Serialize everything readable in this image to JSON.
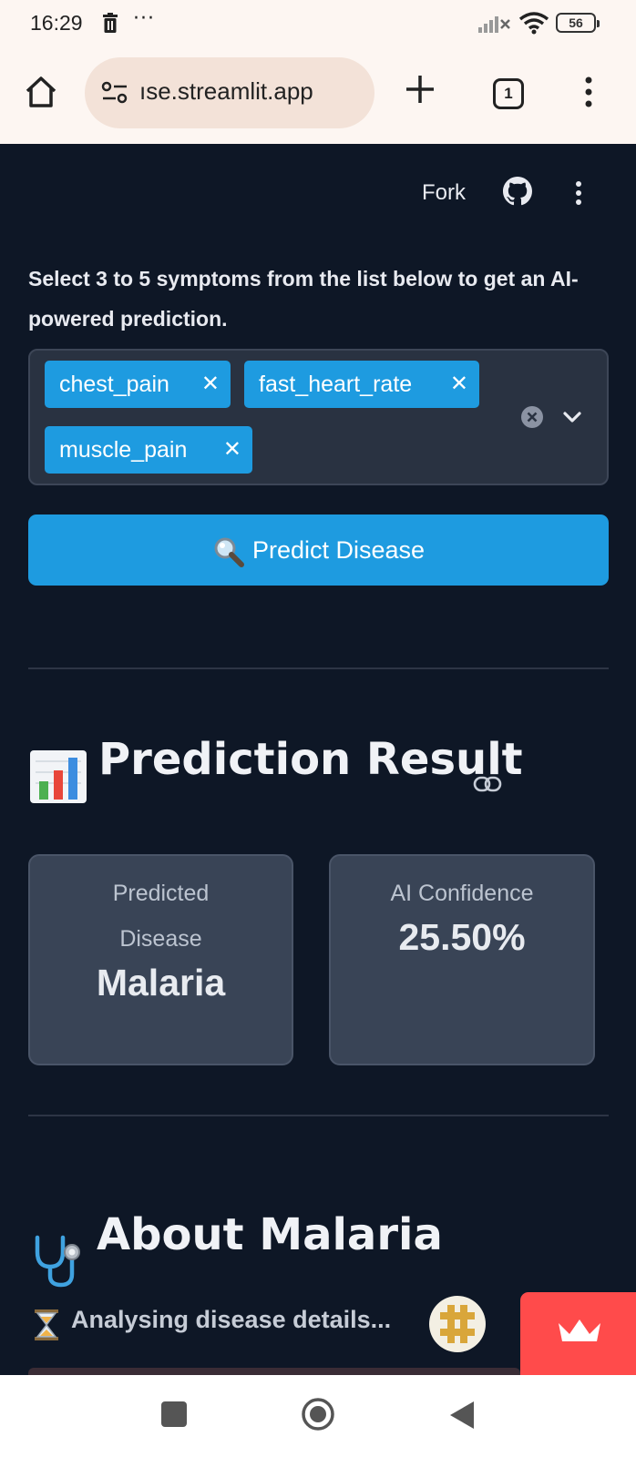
{
  "status_bar": {
    "time": "16:29",
    "more_dots": "···",
    "battery": "56"
  },
  "browser": {
    "url": "ıse.streamlit.app",
    "tab_count": "1"
  },
  "app_toolbar": {
    "fork_label": "Fork"
  },
  "instructions": "Select 3 to 5 symptoms from the list below to get an AI-powered prediction.",
  "symptom_select": {
    "selected": [
      "chest_pain",
      "fast_heart_rate",
      "muscle_pain"
    ],
    "remove_glyph": "✕"
  },
  "predict_button": {
    "label": "Predict Disease"
  },
  "result_section": {
    "heading": "Prediction Result",
    "predicted_label": "Predicted Disease",
    "predicted_value": "Malaria",
    "confidence_label": "AI Confidence",
    "confidence_value": "25.50%"
  },
  "about_section": {
    "heading": "About Malaria",
    "loading_text": "Analysing disease details..."
  },
  "colors": {
    "app_background": "#0e1726",
    "accent_blue": "#1e9be0",
    "card_background": "#394456",
    "streamlit_red": "#ff4b4b",
    "browser_chrome": "#fdf6f2"
  },
  "icons": [
    "trash-icon",
    "signal-icon",
    "wifi-icon",
    "home-icon",
    "tune-icon",
    "plus-icon",
    "kebab-icon",
    "github-icon",
    "clear-icon",
    "chevron-down-icon",
    "magnifier-icon",
    "bar-chart-icon",
    "link-icon",
    "stethoscope-icon",
    "hourglass-icon",
    "crown-icon"
  ]
}
